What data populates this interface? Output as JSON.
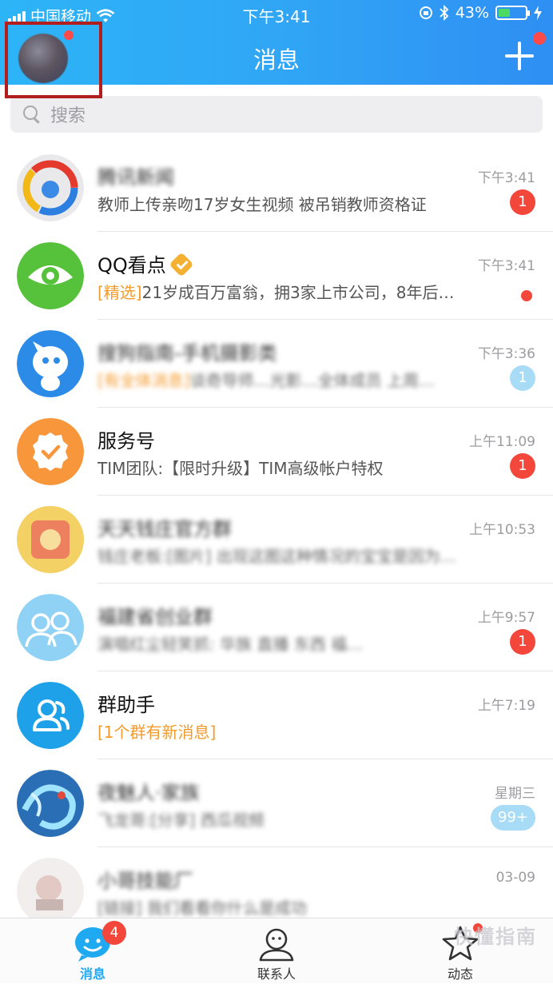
{
  "status_bar": {
    "carrier": "中国移动",
    "time": "下午3:41",
    "battery": "43%",
    "battery_level": 0.43
  },
  "header": {
    "title": "消息"
  },
  "search": {
    "placeholder": "搜索"
  },
  "conversations": [
    {
      "title": "腾讯新闻",
      "subtitle": "教师上传亲吻17岁女生视频 被吊销教师资格证",
      "time": "下午3:41",
      "badge": "1",
      "icon": "tencent-news-icon",
      "title_blurred": true
    },
    {
      "title": "QQ看点",
      "tag": "[精选]",
      "subtitle": "21岁成百万富翁，拥3家上市公司，8年后…",
      "time": "下午3:41",
      "icon": "qq-kandian-icon",
      "verified": true,
      "dot": true
    },
    {
      "title": "搜狗指南-手机摄影类",
      "tag": "[有全体消息]",
      "subtitle": "谈奇导师…光影…全体成员 上周…",
      "time": "下午3:36",
      "badge": "1",
      "badge_muted": true,
      "icon": "sogou-group-icon",
      "title_blurred": true,
      "subtitle_blurred": true
    },
    {
      "title": "服务号",
      "subtitle": "TIM团队:【限时升级】TIM高级帐户特权",
      "time": "上午11:09",
      "badge": "1",
      "icon": "service-account-icon"
    },
    {
      "title": "天天钱庄官方群",
      "subtitle": "钱庄老板:[图片] 出现这图这种情况的宝宝是因为…",
      "time": "上午10:53",
      "icon": "group-avatar-icon",
      "title_blurred": true,
      "subtitle_blurred": true
    },
    {
      "title": "福建省创业群",
      "subtitle": "演唱红尘轻笑抓: 华族 直播 东西 福…",
      "time": "上午9:57",
      "badge": "1",
      "icon": "group-people-icon",
      "title_blurred": true,
      "subtitle_blurred": true
    },
    {
      "title": "群助手",
      "tag": "[1个群有新消息]",
      "subtitle": "",
      "time": "上午7:19",
      "icon": "group-helper-icon"
    },
    {
      "title": "夜魅人·家族",
      "subtitle": "飞龙哥:[分享] 西瓜视频",
      "time": "星期三",
      "badge": "99+",
      "badge_muted": true,
      "icon": "dragon-avatar-icon",
      "title_blurred": true,
      "subtitle_blurred": true
    },
    {
      "title": "小哥技能厂",
      "subtitle": "[链接] 我们看看你什么是成功",
      "time": "03-09",
      "icon": "user-avatar-icon",
      "title_blurred": true,
      "subtitle_blurred": true
    }
  ],
  "tabbar": {
    "messages": {
      "label": "消息",
      "badge": "4"
    },
    "contacts": {
      "label": "联系人"
    },
    "dynamics": {
      "label": "动态"
    }
  },
  "watermark": "快懂指南"
}
